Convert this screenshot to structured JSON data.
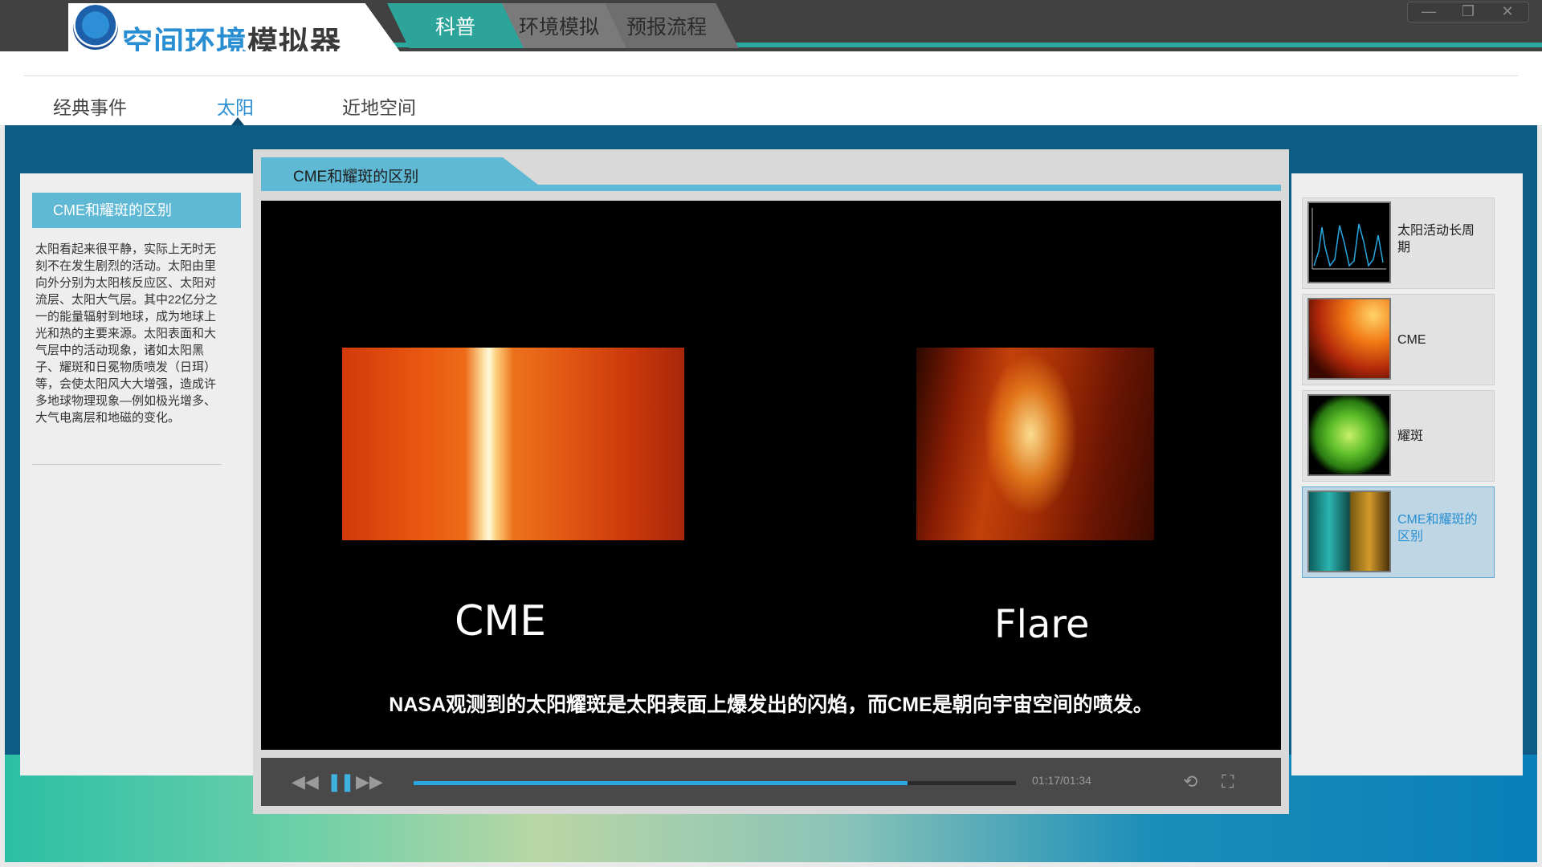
{
  "app": {
    "title_accent": "空间环境",
    "title_rest": "模拟器"
  },
  "top_tabs": [
    {
      "label": "科普",
      "active": true
    },
    {
      "label": "环境模拟",
      "active": false
    },
    {
      "label": "预报流程",
      "active": false
    }
  ],
  "window_controls": {
    "minimize": "—",
    "restore": "❐",
    "close": "✕"
  },
  "sub_nav": [
    {
      "label": "经典事件",
      "active": false
    },
    {
      "label": "太阳",
      "active": true
    },
    {
      "label": "近地空间",
      "active": false
    }
  ],
  "left_panel": {
    "title": "CME和耀斑的区别",
    "body": "太阳看起来很平静，实际上无时无刻不在发生剧烈的活动。太阳由里向外分别为太阳核反应区、太阳对流层、太阳大气层。其中22亿分之一的能量辐射到地球，成为地球上光和热的主要来源。太阳表面和大气层中的活动现象，诸如太阳黑子、耀斑和日冕物质喷发（日珥）等，会使太阳风大大增强，造成许多地球物理现象—例如极光增多、大气电离层和地磁的变化。"
  },
  "video": {
    "title": "CME和耀斑的区别",
    "label_left": "CME",
    "label_right": "Flare",
    "subtitle": "NASA观测到的太阳耀斑是太阳表面上爆发出的闪焰，而CME是朝向宇宙空间的喷发。",
    "time": "01:17/01:34",
    "progress": 0.82
  },
  "playlist": [
    {
      "label": "太阳活动长周期",
      "icon": "solar-cycle-chart-thumbnail",
      "active": false
    },
    {
      "label": "CME",
      "icon": "cme-thumbnail",
      "active": false
    },
    {
      "label": "耀斑",
      "icon": "flare-thumbnail",
      "active": false
    },
    {
      "label": "CME和耀斑的区别",
      "icon": "cme-vs-flare-thumbnail",
      "active": true
    }
  ],
  "colors": {
    "accent_blue": "#2a8fd2",
    "teal_tab": "#2ca49a",
    "panel_header": "#5fb8d4",
    "progress": "#2aa7e0"
  }
}
